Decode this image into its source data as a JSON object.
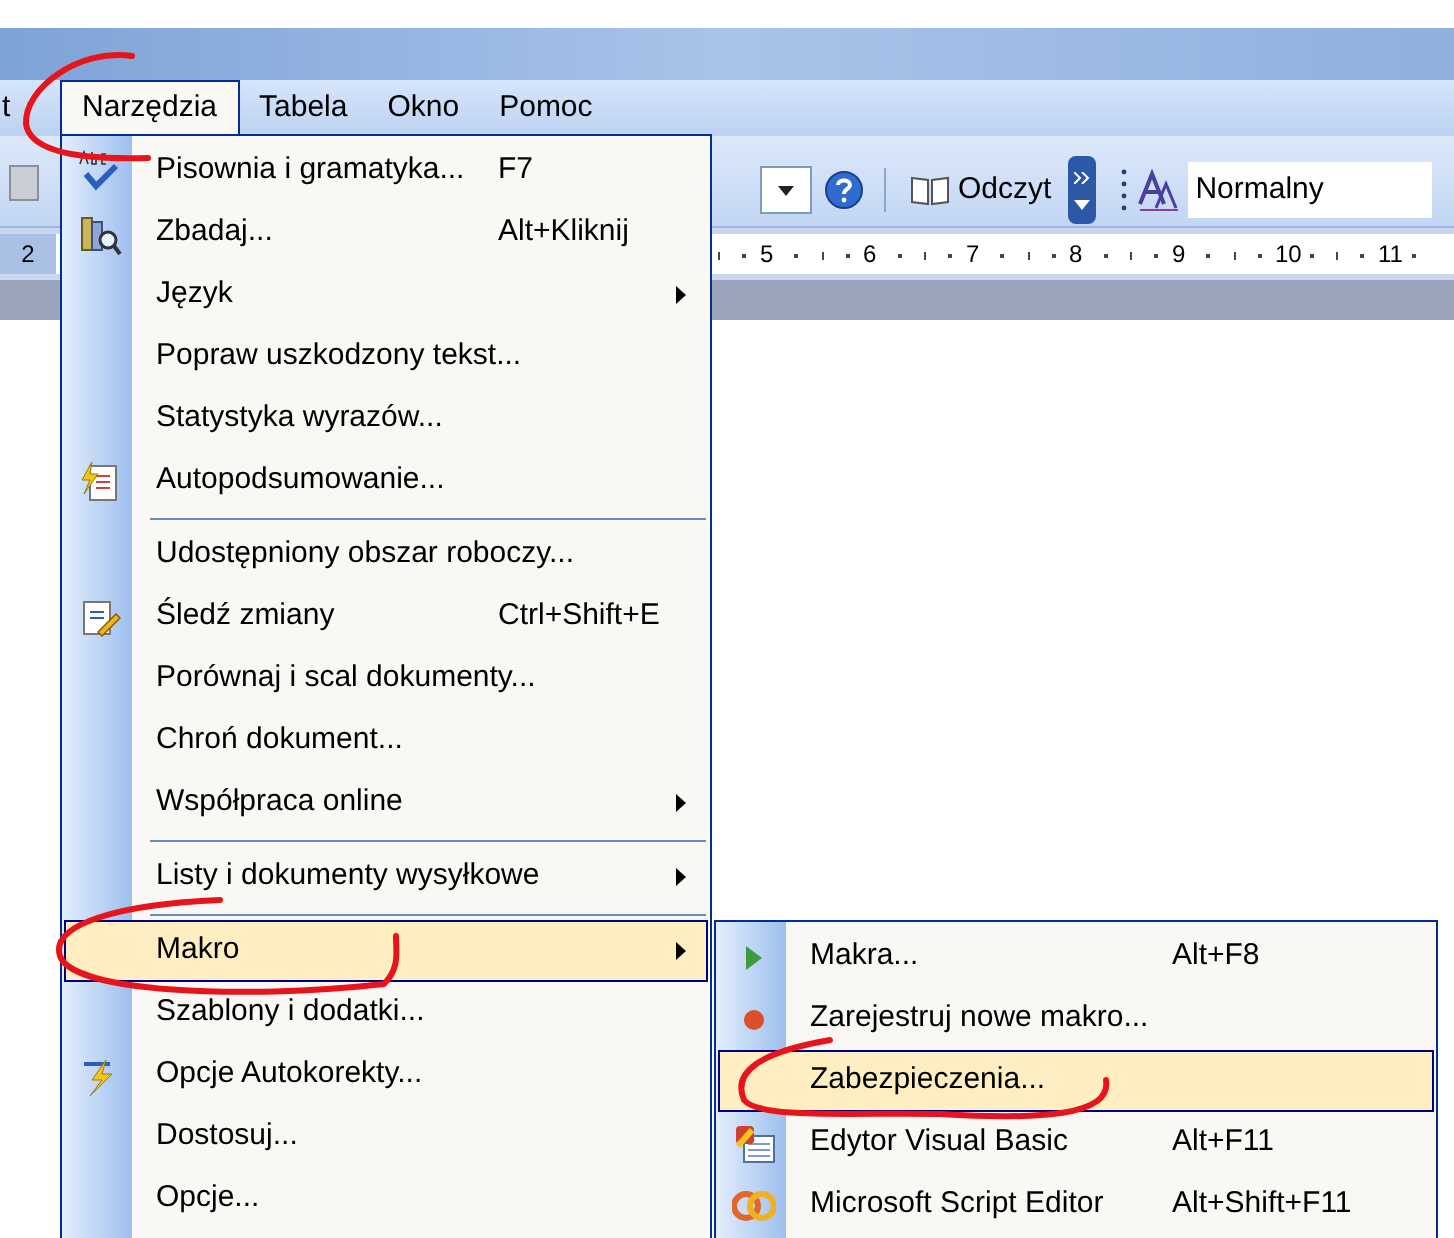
{
  "menu_bar": [
    {
      "label": "t",
      "selected": false
    },
    {
      "label": "Narzędzia",
      "selected": true
    },
    {
      "label": "Tabela",
      "selected": false
    },
    {
      "label": "Okno",
      "selected": false
    },
    {
      "label": "Pomoc",
      "selected": false
    }
  ],
  "toolbar": {
    "view_button": "Odczyt",
    "style_field": "Normalny"
  },
  "ruler": {
    "left_label": "2",
    "labels": [
      "5",
      "6",
      "7",
      "8",
      "9",
      "10",
      "11"
    ]
  },
  "tools_menu": {
    "items": [
      {
        "kind": "item",
        "label": "Pisownia i gramatyka...",
        "shortcut": "F7",
        "submenu": false,
        "selected": false
      },
      {
        "kind": "item",
        "label": "Zbadaj...",
        "shortcut": "Alt+Kliknij",
        "submenu": false,
        "selected": false
      },
      {
        "kind": "item",
        "label": "Język",
        "submenu": true,
        "selected": false
      },
      {
        "kind": "item",
        "label": "Popraw uszkodzony tekst...",
        "submenu": false,
        "selected": false
      },
      {
        "kind": "item",
        "label": "Statystyka wyrazów...",
        "submenu": false,
        "selected": false
      },
      {
        "kind": "item",
        "label": "Autopodsumowanie...",
        "submenu": false,
        "selected": false
      },
      {
        "kind": "separator"
      },
      {
        "kind": "item",
        "label": "Udostępniony obszar roboczy...",
        "submenu": false,
        "selected": false
      },
      {
        "kind": "item",
        "label": "Śledź zmiany",
        "shortcut": "Ctrl+Shift+E",
        "submenu": false,
        "selected": false
      },
      {
        "kind": "item",
        "label": "Porównaj i scal dokumenty...",
        "submenu": false,
        "selected": false
      },
      {
        "kind": "item",
        "label": "Chroń dokument...",
        "submenu": false,
        "selected": false
      },
      {
        "kind": "item",
        "label": "Współpraca online",
        "submenu": true,
        "selected": false
      },
      {
        "kind": "separator"
      },
      {
        "kind": "item",
        "label": "Listy i dokumenty wysyłkowe",
        "submenu": true,
        "selected": false
      },
      {
        "kind": "separator"
      },
      {
        "kind": "item",
        "label": "Makro",
        "submenu": true,
        "selected": true
      },
      {
        "kind": "item",
        "label": "Szablony i dodatki...",
        "submenu": false,
        "selected": false
      },
      {
        "kind": "item",
        "label": "Opcje Autokorekty...",
        "submenu": false,
        "selected": false
      },
      {
        "kind": "item",
        "label": "Dostosuj...",
        "submenu": false,
        "selected": false
      },
      {
        "kind": "item",
        "label": "Opcje...",
        "submenu": false,
        "selected": false
      }
    ]
  },
  "macro_submenu": {
    "items": [
      {
        "kind": "item",
        "label": "Makra...",
        "shortcut": "Alt+F8",
        "submenu": false,
        "selected": false
      },
      {
        "kind": "item",
        "label": "Zarejestruj nowe makro...",
        "submenu": false,
        "selected": false
      },
      {
        "kind": "item",
        "label": "Zabezpieczenia...",
        "submenu": false,
        "selected": true
      },
      {
        "kind": "item",
        "label": "Edytor Visual Basic",
        "shortcut": "Alt+F11",
        "submenu": false,
        "selected": false
      },
      {
        "kind": "item",
        "label": "Microsoft Script Editor",
        "shortcut": "Alt+Shift+F11",
        "submenu": false,
        "selected": false
      }
    ]
  }
}
